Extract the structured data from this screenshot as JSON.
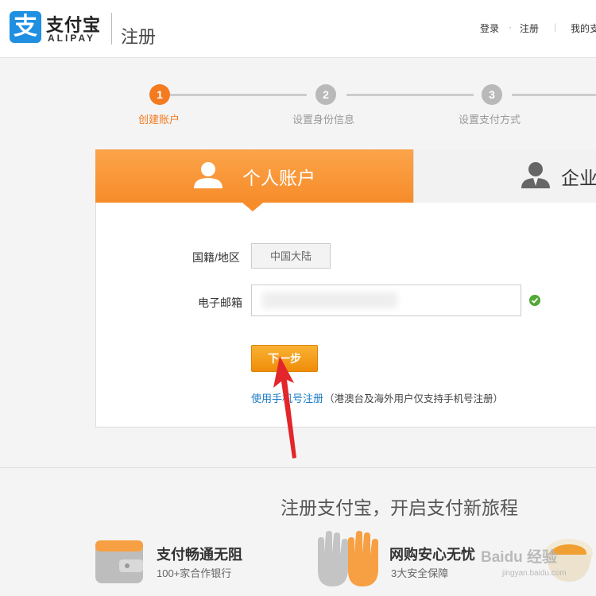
{
  "header": {
    "logo_glyph": "支",
    "brand_name": "支付宝",
    "brand_sub": "ALIPAY",
    "title": "注册",
    "nav": {
      "login": "登录",
      "separator": "·",
      "register": "注册",
      "my": "我的支"
    }
  },
  "steps": [
    {
      "number": "1",
      "label": "创建账户",
      "active": true
    },
    {
      "number": "2",
      "label": "设置身份信息",
      "active": false
    },
    {
      "number": "3",
      "label": "设置支付方式",
      "active": false
    }
  ],
  "tabs": {
    "personal": "个人账户",
    "business": "企业"
  },
  "form": {
    "country_label": "国籍/地区",
    "country_value": "中国大陆",
    "email_label": "电子邮箱",
    "next_button": "下一步",
    "phone_link": "使用手机号注册",
    "phone_note": "（港澳台及海外用户仅支持手机号注册）"
  },
  "bottom": {
    "slogan": "注册支付宝，开启支付新旅程",
    "features": [
      {
        "title": "支付畅通无阻",
        "subtitle": "100+家合作银行"
      },
      {
        "title": "网购安心无忧",
        "subtitle": "3大安全保障"
      }
    ]
  },
  "watermark": {
    "text": "Baidu 经验",
    "sub": "jingyan.baidu.com"
  },
  "colors": {
    "accent": "#f47a20",
    "brand": "#1e8fe1",
    "link": "#1a7bc4",
    "success": "#52a838"
  }
}
